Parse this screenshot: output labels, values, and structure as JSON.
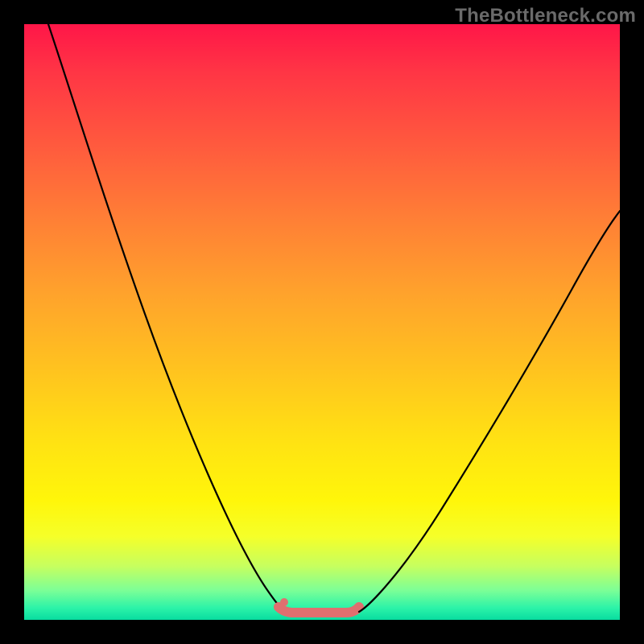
{
  "watermark": "TheBottleneck.com",
  "colors": {
    "flat_band": "#e06f6f",
    "curve": "#000000",
    "frame_bg": "#000000"
  },
  "chart_data": {
    "type": "line",
    "title": "",
    "xlabel": "",
    "ylabel": "",
    "xlim": [
      0,
      100
    ],
    "ylim": [
      0,
      100
    ],
    "series": [
      {
        "name": "left-curve",
        "x": [
          4,
          8,
          12,
          16,
          20,
          24,
          28,
          32,
          36,
          40,
          44
        ],
        "values": [
          100,
          90,
          79,
          68,
          57,
          46,
          35,
          24,
          14,
          6,
          1
        ]
      },
      {
        "name": "right-curve",
        "x": [
          56,
          60,
          64,
          68,
          72,
          76,
          80,
          84,
          88,
          92,
          96,
          100
        ],
        "values": [
          1,
          4,
          9,
          15,
          22,
          29,
          36,
          43,
          50,
          57,
          63,
          69
        ]
      },
      {
        "name": "flat-minimum-band",
        "x": [
          44,
          46,
          48,
          50,
          52,
          54,
          56
        ],
        "values": [
          1.5,
          1,
          1,
          1,
          1,
          1,
          1.5
        ]
      }
    ],
    "annotations": [
      {
        "text": "TheBottleneck.com",
        "position": "top-right"
      }
    ]
  }
}
